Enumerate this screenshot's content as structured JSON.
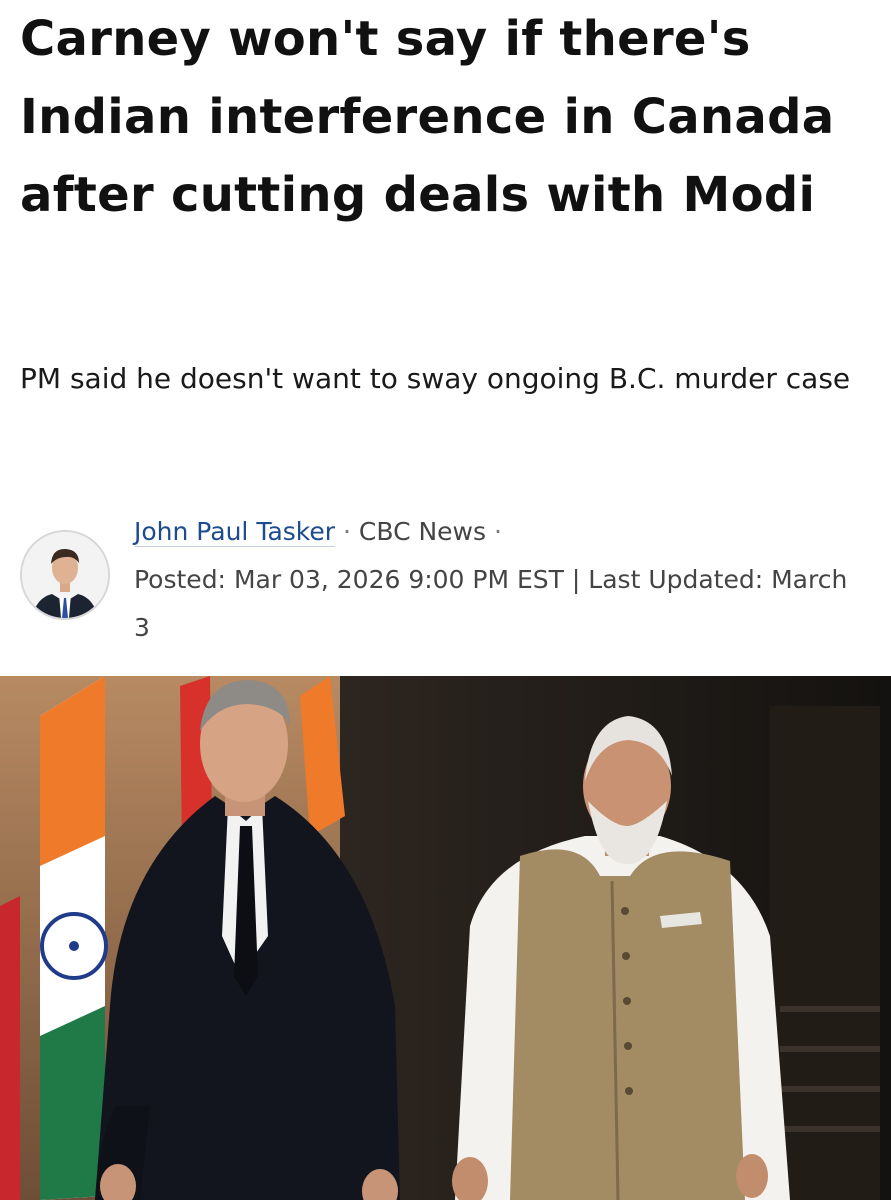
{
  "article": {
    "headline": "Carney won't say if there's Indian interference in Canada after cutting deals with Modi",
    "deck": "PM said he doesn't want to sway ongoing B.C. murder case",
    "byline": {
      "author": "John Paul Tasker",
      "separator": "·",
      "outlet": "CBC News",
      "posted_label": "Posted:",
      "posted_date": "Mar 03, 2026 9:00 PM EST",
      "divider": "|",
      "updated_label": "Last Updated:",
      "updated_date": "March 3"
    }
  },
  "icons": {
    "avatar": "author-portrait-icon"
  },
  "colors": {
    "link": "#1d4b8f",
    "text": "#111111",
    "meta": "#444444"
  }
}
